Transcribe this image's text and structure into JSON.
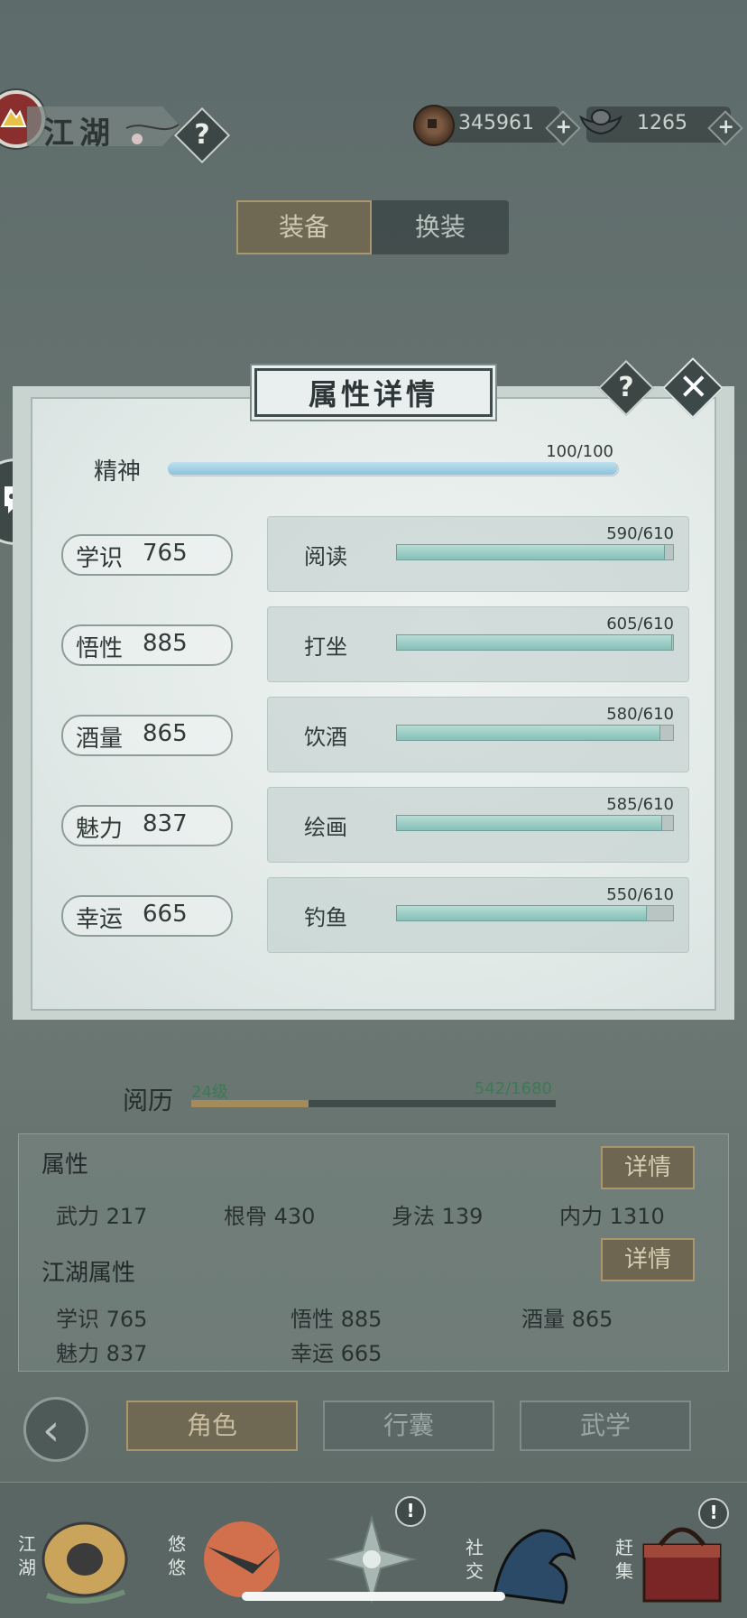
{
  "header": {
    "title": "江湖",
    "help": "?",
    "copper": {
      "value": "345961",
      "plus": "+"
    },
    "silver": {
      "value": "1265",
      "plus": "+"
    }
  },
  "tabs": {
    "equip": "装备",
    "change": "换装"
  },
  "modal": {
    "title": "属性详情",
    "help": "?",
    "close": "✕",
    "spirit": {
      "label": "精神",
      "value": "100/100",
      "ratio": 1.0
    },
    "attributes": [
      {
        "name": "学识",
        "value": "765",
        "activity": "阅读",
        "progress": "590/610",
        "ratio": 0.967
      },
      {
        "name": "悟性",
        "value": "885",
        "activity": "打坐",
        "progress": "605/610",
        "ratio": 0.992
      },
      {
        "name": "酒量",
        "value": "865",
        "activity": "饮酒",
        "progress": "580/610",
        "ratio": 0.951
      },
      {
        "name": "魅力",
        "value": "837",
        "activity": "绘画",
        "progress": "585/610",
        "ratio": 0.959
      },
      {
        "name": "幸运",
        "value": "665",
        "activity": "钓鱼",
        "progress": "550/610",
        "ratio": 0.902
      }
    ]
  },
  "experience": {
    "label": "阅历",
    "level": "24级",
    "value": "542/1680",
    "ratio": 0.323
  },
  "stats": {
    "title": "属性",
    "detail": "详情",
    "items": [
      {
        "label": "武力",
        "value": "217"
      },
      {
        "label": "根骨",
        "value": "430"
      },
      {
        "label": "身法",
        "value": "139"
      },
      {
        "label": "内力",
        "value": "1310"
      }
    ]
  },
  "jianghu_stats": {
    "title": "江湖属性",
    "detail": "详情",
    "items": [
      {
        "label": "学识",
        "value": "765"
      },
      {
        "label": "悟性",
        "value": "885"
      },
      {
        "label": "酒量",
        "value": "865"
      },
      {
        "label": "魅力",
        "value": "837"
      },
      {
        "label": "幸运",
        "value": "665"
      }
    ]
  },
  "bottom_tabs": {
    "role": "角色",
    "bag": "行囊",
    "martial": "武学"
  },
  "nav": [
    {
      "label": "江湖",
      "badge": ""
    },
    {
      "label": "悠悠",
      "badge": ""
    },
    {
      "label": "",
      "badge": "!"
    },
    {
      "label": "社交",
      "badge": ""
    },
    {
      "label": "赶集",
      "badge": "!"
    }
  ],
  "colors": {
    "accent_gold": "#a9966c",
    "bar_teal": "#86c0b7",
    "spirit_blue": "#8cc3dd",
    "exp_green": "#3c7a55"
  }
}
